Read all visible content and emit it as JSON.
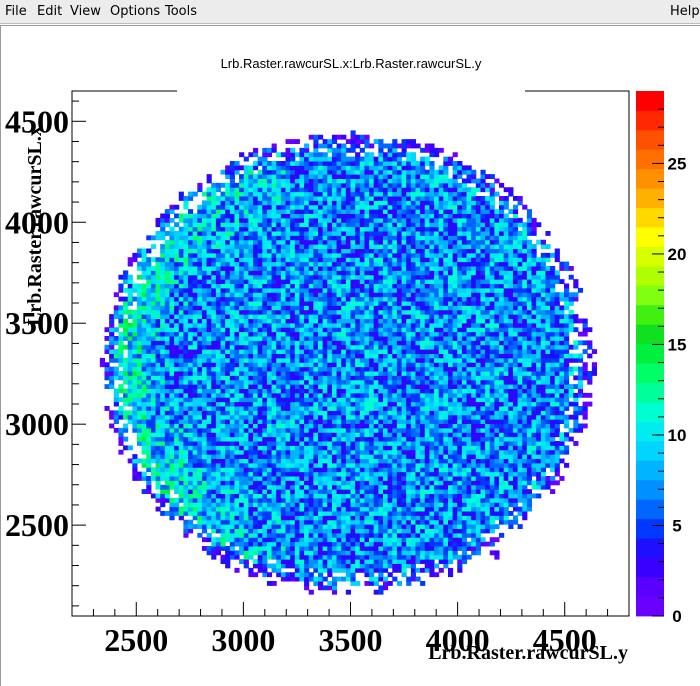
{
  "menu": {
    "file": "File",
    "edit": "Edit",
    "view": "View",
    "options": "Options",
    "tools": "Tools",
    "help": "Help"
  },
  "chart_data": {
    "type": "heatmap",
    "title": "Lrb.Raster.rawcurSL.x:Lrb.Raster.rawcurSL.y",
    "xlabel": "Lrb.Raster.rawcurSL.y",
    "ylabel": "Lrb.Raster.rawcurSL.x",
    "xlim": [
      2200,
      4800
    ],
    "ylim": [
      2050,
      4650
    ],
    "x_ticks": [
      2500,
      3000,
      3500,
      4000,
      4500
    ],
    "y_ticks": [
      2500,
      3000,
      3500,
      4000,
      4500
    ],
    "z_range": [
      0,
      29
    ],
    "z_ticks": [
      0,
      5,
      10,
      15,
      20,
      25
    ],
    "bins": 120,
    "distribution": {
      "center": [
        3490,
        3300
      ],
      "radius": 1150,
      "typical_count": 7,
      "hot_edge": "left, up to ~22 counts near x=2600, y=3000-3900",
      "bottom_tail_to": 2330
    },
    "colors": {
      "palette": [
        "#6a00ff",
        "#5a00ff",
        "#3a00ff",
        "#1e10ff",
        "#0038ff",
        "#0066ff",
        "#0090ff",
        "#00b4ff",
        "#00d4ff",
        "#00ecf0",
        "#00ffd0",
        "#00ff9a",
        "#00ff66",
        "#00f040",
        "#10e020",
        "#40f010",
        "#80ff10",
        "#b0ff00",
        "#d8ff00",
        "#ffff00",
        "#ffd800",
        "#ffb000",
        "#ff9000",
        "#ff7000",
        "#ff5000",
        "#ff2800",
        "#ff0000"
      ]
    }
  }
}
